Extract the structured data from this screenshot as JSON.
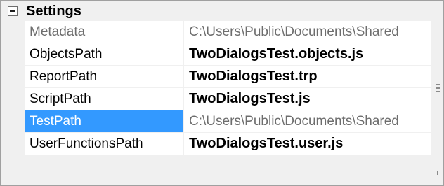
{
  "category": {
    "label": "Settings",
    "expander_icon": "collapse-minus-icon"
  },
  "properties": [
    {
      "name": "Metadata",
      "value": "C:\\Users\\Public\\Documents\\Shared",
      "value_style": "grey",
      "name_style": "grey"
    },
    {
      "name": "ObjectsPath",
      "value": "TwoDialogsTest.objects.js",
      "value_style": "bold"
    },
    {
      "name": "ReportPath",
      "value": "TwoDialogsTest.trp",
      "value_style": "bold"
    },
    {
      "name": "ScriptPath",
      "value": "TwoDialogsTest.js",
      "value_style": "bold"
    },
    {
      "name": "TestPath",
      "value": "C:\\Users\\Public\\Documents\\Shared",
      "value_style": "grey",
      "selected": true
    },
    {
      "name": "UserFunctionsPath",
      "value": "TwoDialogsTest.user.js",
      "value_style": "bold"
    }
  ],
  "colors": {
    "selection": "#3399ff",
    "gutter": "#f0f0f0",
    "readonly_text": "#6d6d6d"
  }
}
